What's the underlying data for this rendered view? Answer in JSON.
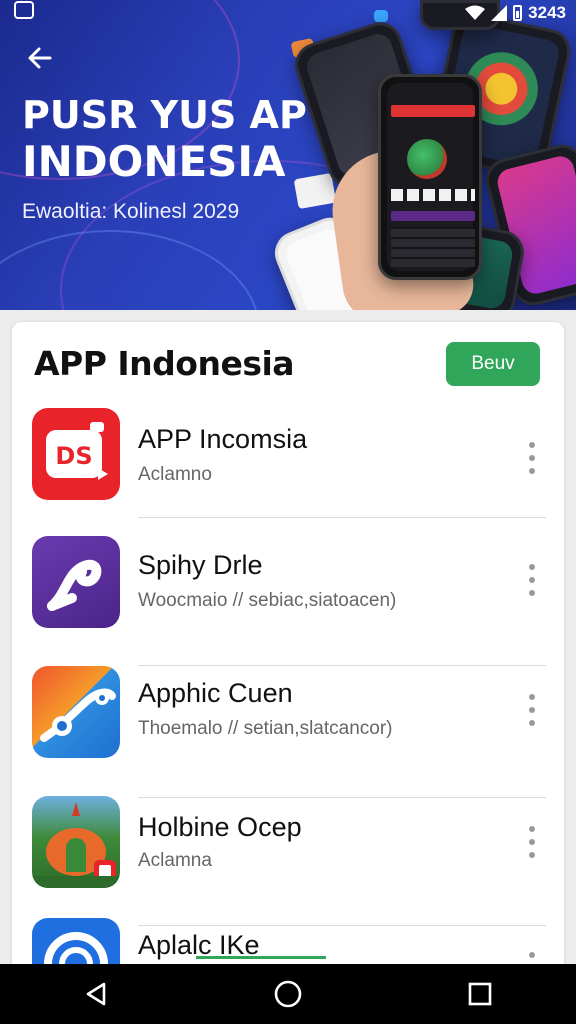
{
  "status_bar": {
    "time": "3243",
    "icons": [
      "app-icon",
      "wifi-icon",
      "signal-icon",
      "battery-icon"
    ]
  },
  "banner": {
    "title_line1": "PUSR YUS AP",
    "title_line2": "INDONESIA",
    "subtitle": "Ewaoltia:  Kolinesl 2029",
    "back_icon": "arrow-left-icon"
  },
  "section": {
    "title": "APP Indonesia",
    "button_label": "Beuv",
    "accent_color": "#2fa65a"
  },
  "apps": [
    {
      "name": "APP Incomsia",
      "subtitle": "Aclamno",
      "icon": "ds-camera-icon"
    },
    {
      "name": "Spihy Drle",
      "subtitle": "Woocmaio // sebiac,siatoacen)",
      "icon": "purple-swirl-icon"
    },
    {
      "name": "Apphic Cuen",
      "subtitle": "Thoemalo // setian,slatcancor)",
      "icon": "blue-bird-icon"
    },
    {
      "name": "Holbine Ocep",
      "subtitle": "Aclamna",
      "icon": "garden-gate-icon"
    },
    {
      "name": "Aplalc IKe",
      "subtitle": "",
      "icon": "blue-ring-icon"
    }
  ],
  "nav": [
    "back-triangle-icon",
    "home-circle-icon",
    "recents-square-icon"
  ]
}
